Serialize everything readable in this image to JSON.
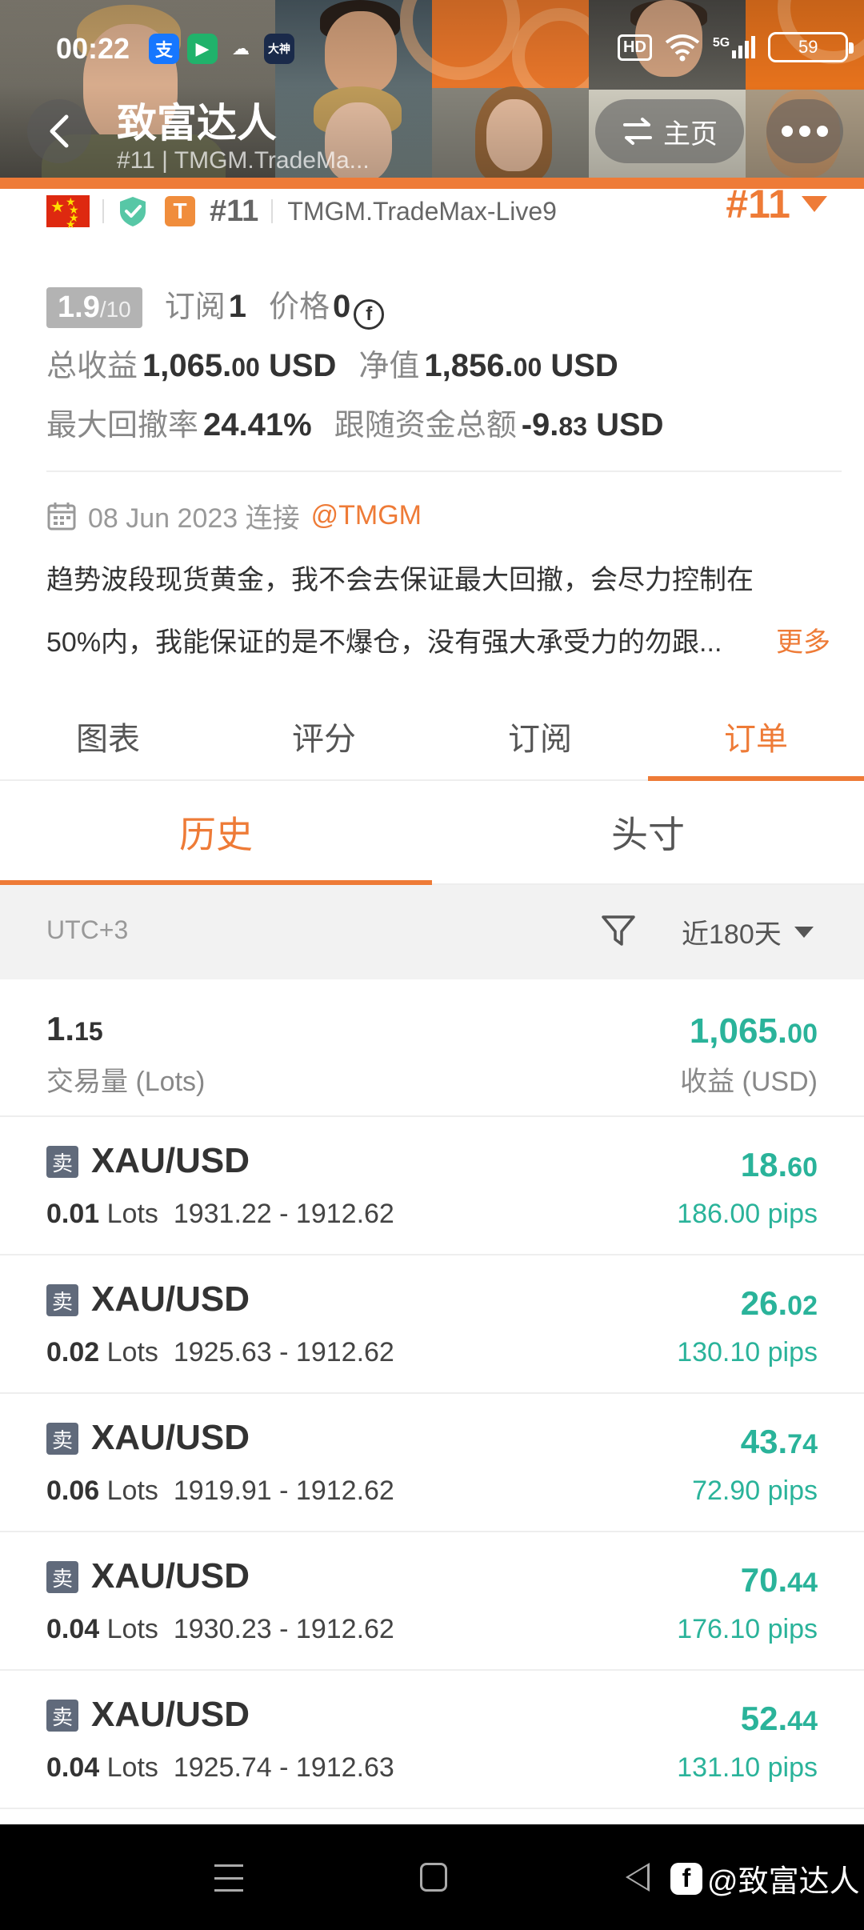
{
  "status_bar": {
    "time": "00:22",
    "app_icons": [
      "alipay-icon",
      "video-app-icon",
      "cloud-icon",
      "dashen-icon"
    ],
    "hd": "HD",
    "network": "5G",
    "battery": "59"
  },
  "header": {
    "title": "致富达人",
    "subtitle": "#11 | TMGM.TradeMa...",
    "home_label": "主页"
  },
  "profile": {
    "rank_small": "#11",
    "broker": "TMGM.TradeMax-Live9",
    "rank_big": "#11",
    "score": "1.9",
    "score_max": "/10",
    "subscribe_label": "订阅",
    "subscribe_value": "1",
    "price_label": "价格",
    "price_value": "0",
    "coin_symbol": "f",
    "total_profit_label": "总收益",
    "total_profit_int": "1,065.",
    "total_profit_dec": "00",
    "total_profit_unit": " USD",
    "net_value_label": "净值",
    "net_value_int": "1,856.",
    "net_value_dec": "00",
    "net_value_unit": " USD",
    "max_drawdown_label": "最大回撤率",
    "max_drawdown_value": "24.41%",
    "follow_funds_label": "跟随资金总额",
    "follow_funds_int": "-9.",
    "follow_funds_dec": "83",
    "follow_funds_unit": " USD",
    "connect_date": "08 Jun 2023 连接",
    "connect_handle": "@TMGM",
    "description_line1": "趋势波段现货黄金，我不会去保证最大回撤，会尽力控制在",
    "description_line2": "50%内，我能保证的是不爆仓，没有强大承受力的勿跟...",
    "more_label": "更多"
  },
  "tabs": [
    "图表",
    "评分",
    "订阅",
    "订单"
  ],
  "subtabs": [
    "历史",
    "头寸"
  ],
  "filter": {
    "timezone": "UTC+3",
    "period": "近180天"
  },
  "summary": {
    "lots_int": "1.",
    "lots_dec": "15",
    "lots_label": "交易量 (Lots)",
    "profit_int": "1,065.",
    "profit_dec": "00",
    "profit_label": "收益 (USD)"
  },
  "orders": [
    {
      "side": "卖",
      "symbol": "XAU/USD",
      "lots": "0.01",
      "lots_unit": "Lots",
      "prices": "1931.22 - 1912.62",
      "profit_int": "18.",
      "profit_dec": "60",
      "pips": "186.00 pips"
    },
    {
      "side": "卖",
      "symbol": "XAU/USD",
      "lots": "0.02",
      "lots_unit": "Lots",
      "prices": "1925.63 - 1912.62",
      "profit_int": "26.",
      "profit_dec": "02",
      "pips": "130.10 pips"
    },
    {
      "side": "卖",
      "symbol": "XAU/USD",
      "lots": "0.06",
      "lots_unit": "Lots",
      "prices": "1919.91 - 1912.62",
      "profit_int": "43.",
      "profit_dec": "74",
      "pips": "72.90 pips"
    },
    {
      "side": "卖",
      "symbol": "XAU/USD",
      "lots": "0.04",
      "lots_unit": "Lots",
      "prices": "1930.23 - 1912.62",
      "profit_int": "70.",
      "profit_dec": "44",
      "pips": "176.10 pips"
    },
    {
      "side": "卖",
      "symbol": "XAU/USD",
      "lots": "0.04",
      "lots_unit": "Lots",
      "prices": "1925.74 - 1912.63",
      "profit_int": "52.",
      "profit_dec": "44",
      "pips": "131.10 pips"
    }
  ],
  "watermark": {
    "logo": "f",
    "text": "@致富达人"
  },
  "colors": {
    "accent": "#ee7b37",
    "profit": "#2ab39a",
    "sell_badge": "#606a7b"
  }
}
